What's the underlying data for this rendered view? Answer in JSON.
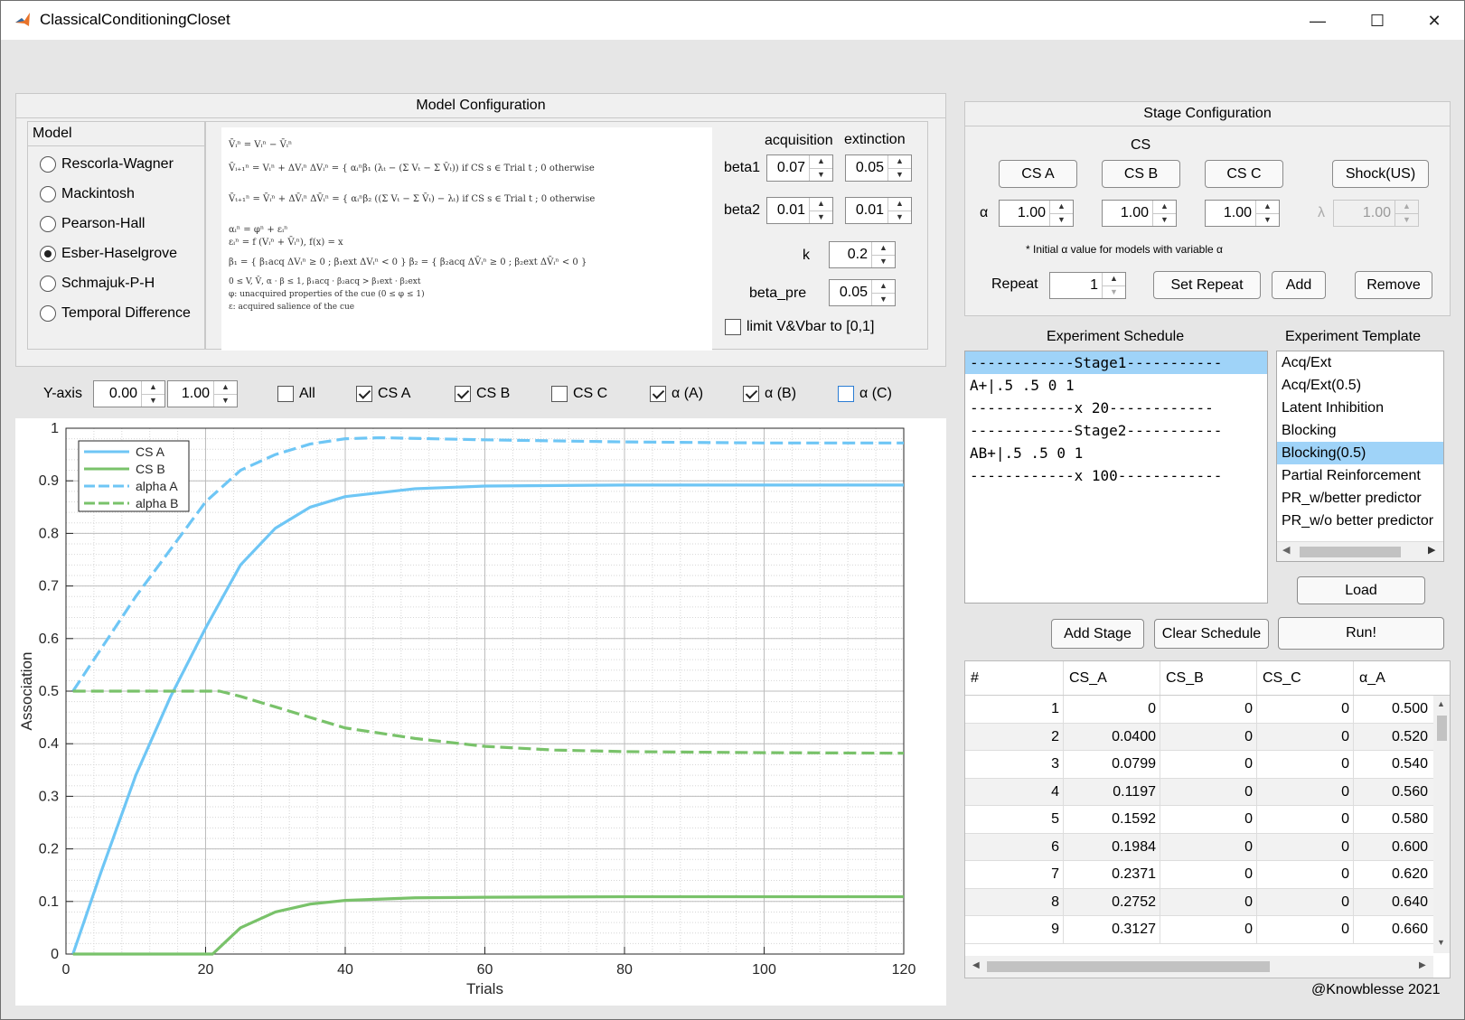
{
  "window": {
    "title": "ClassicalConditioningCloset",
    "minimize": "—",
    "maximize": "☐",
    "close": "✕"
  },
  "model_config": {
    "title": "Model Configuration",
    "model_label": "Model",
    "models": [
      "Rescorla-Wagner",
      "Mackintosh",
      "Pearson-Hall",
      "Esber-Haselgrove",
      "Schmajuk-P-H",
      "Temporal Difference"
    ],
    "selected_model": "Esber-Haselgrove",
    "col_acquisition": "acquisition",
    "col_extinction": "extinction",
    "beta1_label": "beta1",
    "beta1_acq": "0.07",
    "beta1_ext": "0.05",
    "beta2_label": "beta2",
    "beta2_acq": "0.01",
    "beta2_ext": "0.01",
    "k_label": "k",
    "k_value": "0.2",
    "beta_pre_label": "beta_pre",
    "beta_pre_value": "0.05",
    "limit_label": "limit V&Vbar to [0,1]",
    "formula_lines": [
      "V̄ᵢⁿ = Vᵢⁿ − V̄ᵢⁿ",
      "V̄ᵢ₊₁ⁿ = Vᵢⁿ + ΔVᵢⁿ    ΔVᵢⁿ = { αᵢⁿβ₁ (λₜ − (Σ Vₜ − Σ V̄ₜ))  if  CS s ∈ Trial t ;  0  otherwise",
      "V̄ₜ₊₁ⁿ = V̄ᵢⁿ + ΔV̄ᵢⁿ    ΔV̄ᵢⁿ = { αᵢⁿβ₂ ((Σ Vₜ − Σ V̄ₜ) − λₜ)  if  CS s ∈ Trial t ;  0  otherwise",
      "αᵢⁿ = φⁿ + εᵢⁿ",
      "εᵢⁿ = f (Vᵢⁿ + V̄ᵢⁿ),      f(x) = x",
      "β₁ = { β₁acq  ΔVᵢⁿ ≥ 0 ; β₁ext  ΔVᵢⁿ < 0 }    β₂ = { β₂acq  ΔV̄ᵢⁿ ≥ 0 ; β₂ext  ΔV̄ᵢⁿ < 0 }",
      "0 ≤ V, V̄, α · β ≤ 1,    β₁acq · β₂acq > β₁ext · β₂ext",
      "φ: unacquired properties of the cue (0 ≤ φ ≤ 1)",
      "ε: acquired salience of the cue"
    ]
  },
  "stage_config": {
    "title": "Stage Configuration",
    "cs_header": "CS",
    "cs_buttons": [
      "CS A",
      "CS B",
      "CS C"
    ],
    "shock_button": "Shock(US)",
    "alpha_label": "α",
    "alpha_values": [
      "1.00",
      "1.00",
      "1.00"
    ],
    "lambda_label": "λ",
    "lambda_value": "1.00",
    "note": "* Initial α value for models with variable α",
    "repeat_label": "Repeat",
    "repeat_value": "1",
    "set_repeat": "Set Repeat",
    "add": "Add",
    "remove": "Remove"
  },
  "schedule": {
    "title": "Experiment Schedule",
    "lines": [
      "------------Stage1-----------",
      "A+|.5 .5 0 1",
      "------------x 20------------",
      "------------Stage2-----------",
      "AB+|.5 .5 0 1",
      "------------x 100------------"
    ],
    "selected_index": 0,
    "add_stage": "Add Stage",
    "clear_schedule": "Clear Schedule"
  },
  "template": {
    "title": "Experiment Template",
    "items": [
      "Acq/Ext",
      "Acq/Ext(0.5)",
      "Latent Inhibition",
      "Blocking",
      "Blocking(0.5)",
      "Partial Reinforcement",
      "PR_w/better predictor",
      "PR_w/o better predictor"
    ],
    "selected_index": 4,
    "load": "Load",
    "run": "Run!"
  },
  "plot_controls": {
    "yaxis_label": "Y-axis",
    "ymin": "0.00",
    "ymax": "1.00",
    "checks": [
      {
        "label": "All",
        "checked": false
      },
      {
        "label": "CS A",
        "checked": true
      },
      {
        "label": "CS B",
        "checked": true
      },
      {
        "label": "CS C",
        "checked": false
      },
      {
        "label": "α (A)",
        "checked": true
      },
      {
        "label": "α (B)",
        "checked": true
      },
      {
        "label": "α (C)",
        "checked": false
      }
    ]
  },
  "chart_data": {
    "type": "line",
    "xlabel": "Trials",
    "ylabel": "Association",
    "xlim": [
      0,
      120
    ],
    "ylim": [
      0,
      1
    ],
    "xticks": [
      0,
      20,
      40,
      60,
      80,
      100,
      120
    ],
    "yticks": [
      0,
      0.1,
      0.2,
      0.3,
      0.4,
      0.5,
      0.6,
      0.7,
      0.8,
      0.9,
      1
    ],
    "grid": "on (major + minor dotted)",
    "legend_position": "top-left",
    "series": [
      {
        "name": "CS A",
        "color": "#6ec6f5",
        "dash": "solid",
        "x": [
          1,
          5,
          10,
          15,
          20,
          25,
          30,
          35,
          40,
          50,
          60,
          80,
          100,
          120
        ],
        "y": [
          0,
          0.155,
          0.34,
          0.49,
          0.62,
          0.74,
          0.81,
          0.85,
          0.87,
          0.885,
          0.89,
          0.892,
          0.892,
          0.892
        ]
      },
      {
        "name": "CS B",
        "color": "#79c26a",
        "dash": "solid",
        "x": [
          1,
          20,
          21,
          25,
          30,
          35,
          40,
          50,
          60,
          80,
          100,
          120
        ],
        "y": [
          0,
          0,
          0,
          0.05,
          0.08,
          0.095,
          0.102,
          0.107,
          0.108,
          0.109,
          0.109,
          0.109
        ]
      },
      {
        "name": "alpha A",
        "color": "#6ec6f5",
        "dash": "dashed",
        "x": [
          1,
          5,
          10,
          15,
          20,
          25,
          30,
          35,
          40,
          45,
          60,
          80,
          100,
          120
        ],
        "y": [
          0.5,
          0.58,
          0.68,
          0.77,
          0.86,
          0.92,
          0.95,
          0.97,
          0.98,
          0.982,
          0.978,
          0.974,
          0.972,
          0.972
        ]
      },
      {
        "name": "alpha B",
        "color": "#79c26a",
        "dash": "dashed",
        "x": [
          1,
          20,
          22,
          25,
          30,
          35,
          40,
          50,
          60,
          70,
          80,
          100,
          120
        ],
        "y": [
          0.5,
          0.5,
          0.5,
          0.49,
          0.47,
          0.45,
          0.43,
          0.41,
          0.395,
          0.388,
          0.385,
          0.383,
          0.382
        ]
      }
    ]
  },
  "results_table": {
    "columns": [
      "#",
      "CS_A",
      "CS_B",
      "CS_C",
      "α_A"
    ],
    "rows": [
      [
        "1",
        "0",
        "0",
        "0",
        "0.500"
      ],
      [
        "2",
        "0.0400",
        "0",
        "0",
        "0.520"
      ],
      [
        "3",
        "0.0799",
        "0",
        "0",
        "0.540"
      ],
      [
        "4",
        "0.1197",
        "0",
        "0",
        "0.560"
      ],
      [
        "5",
        "0.1592",
        "0",
        "0",
        "0.580"
      ],
      [
        "6",
        "0.1984",
        "0",
        "0",
        "0.600"
      ],
      [
        "7",
        "0.2371",
        "0",
        "0",
        "0.620"
      ],
      [
        "8",
        "0.2752",
        "0",
        "0",
        "0.640"
      ],
      [
        "9",
        "0.3127",
        "0",
        "0",
        "0.660"
      ]
    ]
  },
  "footer": {
    "credit": "@Knowblesse 2021"
  }
}
